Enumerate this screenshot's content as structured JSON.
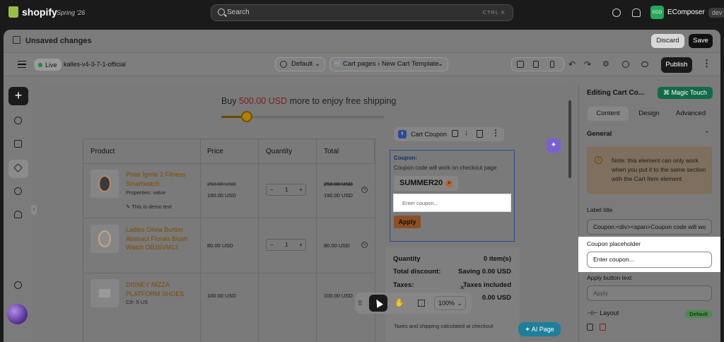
{
  "topbar": {
    "brand": "shopify",
    "release": "Spring '26",
    "search_placeholder": "Search",
    "search_shortcut": "CTRL  K",
    "store_initials": "ECO",
    "store_name": "EComposer",
    "store_badge": "dev"
  },
  "savebar": {
    "message": "Unsaved changes",
    "discard": "Discard",
    "save": "Save"
  },
  "editor_toolbar": {
    "status": "Live",
    "theme_name": "kalles-v4-3-7-1-official",
    "language": "Default",
    "page_type": "Cart pages",
    "template": "New Cart Template",
    "publish": "Publish"
  },
  "canvas": {
    "shipping": {
      "prefix": "Buy ",
      "amount": "500.00 USD",
      "middle": " more to enjoy ",
      "bold": "free shipping",
      "progress": 0.15
    },
    "table_headers": [
      "Product",
      "Price",
      "Quantity",
      "Total"
    ],
    "items": [
      {
        "name_line1": "Polar Ignite 2 Fitness",
        "name_line2": "Smartwatch",
        "prop": "Properties: value",
        "note": "This is demo text",
        "old_price": "250.00 USD",
        "price": "190.00 USD",
        "qty": "1",
        "old_total": "250.00 USD",
        "total": "190.00 USD"
      },
      {
        "name_line1": "Ladies Olivia Burton",
        "name_line2": "Abstract Florals Blush",
        "name_line3": "Watch OB16VM12",
        "price": "80.00 USD",
        "qty": "1",
        "total": "80.00 USD"
      },
      {
        "name_line1": "DISNEY NIZZA",
        "name_line2": "PLATFORM SHOES",
        "prop": "Cỡ: 5 US",
        "price": "100.00 USD",
        "qty": "1",
        "total": "100.00 USD"
      }
    ],
    "qty_minus": "−",
    "qty_plus": "+",
    "coupon_toolbar_label": "Cart Coupon",
    "coupon_badge": "t",
    "coupon_label": "Coupon:",
    "coupon_desc": "Coupon code will work on checkout page",
    "coupon_code": "SUMMER20",
    "coupon_placeholder": "Enter coupon...",
    "coupon_apply": "Apply",
    "summary": [
      {
        "label": "Quantity",
        "value": "0 item(s)"
      },
      {
        "label": "Total discount:",
        "value": "Saving 0.00 USD"
      },
      {
        "label": "Taxes:",
        "value": "Taxes included"
      },
      {
        "label": "",
        "value": "0.00 USD"
      }
    ],
    "summary_footer": "Taxes and shipping calculated at checkout",
    "ai_page": "AI Page",
    "zoom": "100%"
  },
  "panel": {
    "title": "Editing Cart Co...",
    "magic_touch": "Magic Touch",
    "tabs": [
      "Content",
      "Design",
      "Advanced"
    ],
    "section": "General",
    "note": "Note: this element can only work when you put it to the same section with the Cart Item element",
    "label_title": "Label title",
    "label_title_value": "Coupon:<div><span>Coupon code will wo",
    "coupon_placeholder_label": "Coupon placeholder",
    "coupon_placeholder_value": "Enter coupon...",
    "apply_button_label": "Apply button text",
    "apply_button_placeholder": "Apply",
    "layout_label": "Layout",
    "layout_value": "Default"
  }
}
